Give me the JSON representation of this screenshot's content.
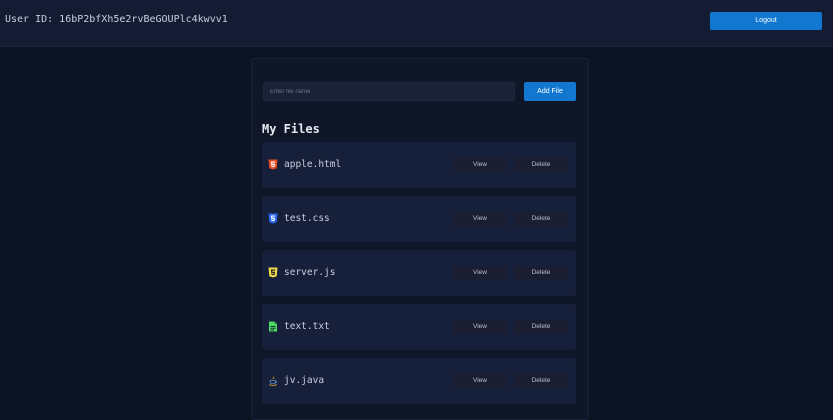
{
  "header": {
    "user_id_text": "User ID: 16bP2bfXh5e2rvBeGOUPlc4kwvv1",
    "logout_label": "Logout"
  },
  "add_file": {
    "placeholder": "Enter file name",
    "value": "",
    "button_label": "Add File"
  },
  "files_section": {
    "title": "My Files"
  },
  "files": [
    {
      "name": "apple.html",
      "icon": "html5-icon",
      "icon_color": "#e44d26",
      "view_label": "View",
      "delete_label": "Delete"
    },
    {
      "name": "test.css",
      "icon": "css3-icon",
      "icon_color": "#2965f1",
      "view_label": "View",
      "delete_label": "Delete"
    },
    {
      "name": "server.js",
      "icon": "js-icon",
      "icon_color": "#f0db4f",
      "view_label": "View",
      "delete_label": "Delete"
    },
    {
      "name": "text.txt",
      "icon": "text-file-icon",
      "icon_color": "#4cd964",
      "view_label": "View",
      "delete_label": "Delete"
    },
    {
      "name": "jv.java",
      "icon": "java-icon",
      "icon_color": "#e5a135",
      "view_label": "View",
      "delete_label": "Delete"
    }
  ],
  "colors": {
    "background": "#0c1322",
    "topbar": "#141c33",
    "panel": "#0f1628",
    "card": "#16203a",
    "accent": "#1177cf"
  }
}
